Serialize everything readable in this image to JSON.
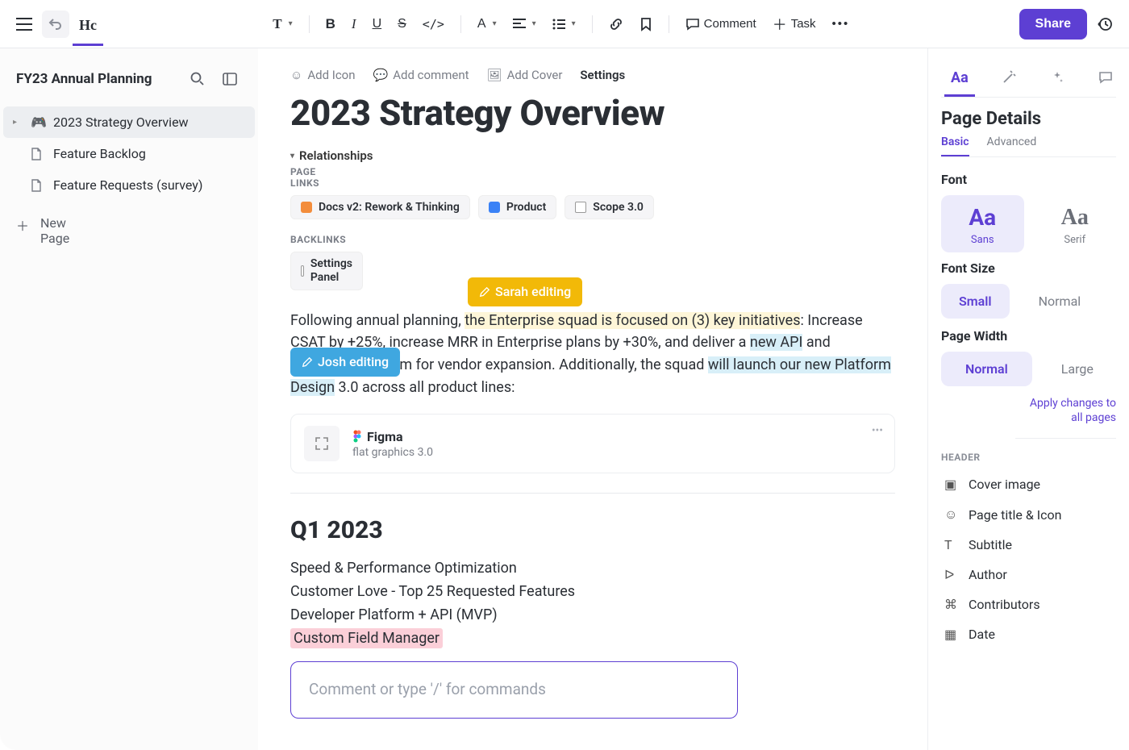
{
  "toolbar": {
    "logo": "Hc",
    "comment": "Comment",
    "task": "Task",
    "share": "Share"
  },
  "sidebar": {
    "title": "FY23 Annual Planning",
    "items": [
      {
        "label": "2023 Strategy Overview",
        "icon": "🎮",
        "active": true
      },
      {
        "label": "Feature Backlog",
        "icon": "doc"
      },
      {
        "label": "Feature Requests (survey)",
        "icon": "doc"
      }
    ],
    "new_page": "New Page"
  },
  "page": {
    "actions": {
      "add_icon": "Add Icon",
      "add_comment": "Add comment",
      "add_cover": "Add Cover",
      "settings": "Settings"
    },
    "title": "2023 Strategy Overview",
    "relationships": "Relationships",
    "page_links_label": "PAGE LINKS",
    "page_links": [
      {
        "label": "Docs v2: Rework & Thinking",
        "color": "orange"
      },
      {
        "label": "Product",
        "color": "blue"
      },
      {
        "label": "Scope 3.0",
        "color": "doc"
      }
    ],
    "backlinks_label": "BACKLINKS",
    "backlinks": [
      {
        "label": "Settings Panel"
      }
    ],
    "editors": {
      "sarah": "Sarah editing",
      "josh": "Josh editing"
    },
    "body": {
      "p1_a": "Following annual planning, ",
      "p1_b": "the Enterprise squad is focused on (3) key initiatives",
      "p1_c": ": Increase CSAT by +25%, increase MRR in Enterprise plans by +30%, and deliver a ",
      "p1_d": "new API",
      "p1_e": " and developer platform for vendor expansion. Additionally, the squad ",
      "p1_f": "will launch our new Platform Design",
      "p1_g": " 3.0 across all product lines:"
    },
    "embed": {
      "name": "Figma",
      "subtitle": "flat graphics 3.0"
    },
    "q1_heading": "Q1 2023",
    "q1_items": [
      "Speed & Performance Optimization",
      "Customer Love - Top 25 Requested Features",
      "Developer Platform + API (MVP)",
      "Custom Field Manager"
    ],
    "comment_placeholder": "Comment or type '/' for commands"
  },
  "panel": {
    "heading": "Page Details",
    "subtabs": {
      "basic": "Basic",
      "advanced": "Advanced"
    },
    "font_label": "Font",
    "font_opts": {
      "sans": "Sans",
      "serif": "Serif"
    },
    "font_size_label": "Font Size",
    "font_sizes": {
      "small": "Small",
      "normal": "Normal"
    },
    "page_width_label": "Page Width",
    "page_widths": {
      "normal": "Normal",
      "large": "Large"
    },
    "apply": "Apply changes to all pages",
    "header_label": "HEADER",
    "header_items": [
      "Cover image",
      "Page title & Icon",
      "Subtitle",
      "Author",
      "Contributors",
      "Date"
    ]
  }
}
